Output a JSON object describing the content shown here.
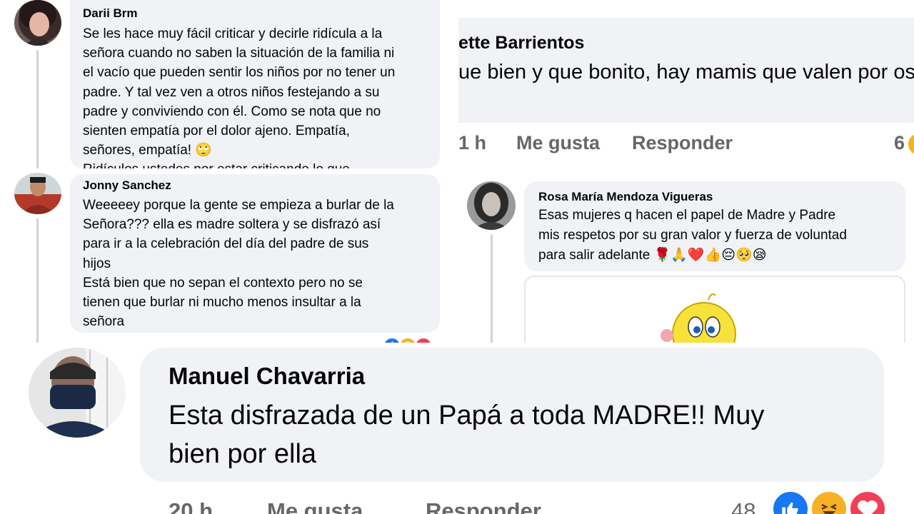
{
  "comments": [
    {
      "author": "Darii Brm",
      "text": "Se les hace muy fácil criticar y decirle ridícula a la\nseñora cuando no saben la situación de la familia ni\nel vacío que pueden sentir los niños por no tener un\npadre. Y tal vez ven a otros niños festejando a su\npadre y conviviendo con él. Como se nota que no\nsienten empatía por el dolor ajeno. Empatía,\nseñores, empatía! 🙄\nRidículos ustedes por estar criticando lo que"
    },
    {
      "author": "Jonny Sanchez",
      "text": "Weeeeey porque la gente se empieza a burlar de la\nSeñora??? ella es madre soltera y se disfrazó así\npara ir a la celebración del día del padre de sus\nhijos\nEstá bien que no sepan el contexto pero no se\ntienen que burlar ni mucho menos insultar a la\nseñora"
    },
    {
      "author": "ette Barrientos",
      "text": "ue bien y que bonito, hay mamis que valen por\nos y papis por igual; ninguno se debe demeritar",
      "time": "1 h",
      "like_label": "Me gusta",
      "reply_label": "Responder",
      "reaction_count": "6"
    },
    {
      "author": "Rosa María Mendoza Vigueras",
      "text": "Esas mujeres q hacen el papel de Madre y Padre\nmis respetos por su gran valor y fuerza de voluntad\npara salir adelante 🌹🙏❤️👍😔🥺😪"
    },
    {
      "author": "Manuel Chavarria",
      "text": "Esta disfrazada de un Papá a toda MADRE!! Muy\nbien por ella",
      "time": "20 h",
      "like_label": "Me gusta",
      "reply_label": "Responder",
      "reaction_count": "48"
    }
  ],
  "colors": {
    "bubble": "#f0f2f5",
    "meta_text": "#65676b",
    "like_blue": "#1877f2",
    "haha_yellow": "#f7b125",
    "love_red": "#f33e58"
  },
  "icons": [
    "like-reaction-icon",
    "haha-reaction-icon",
    "love-reaction-icon"
  ]
}
